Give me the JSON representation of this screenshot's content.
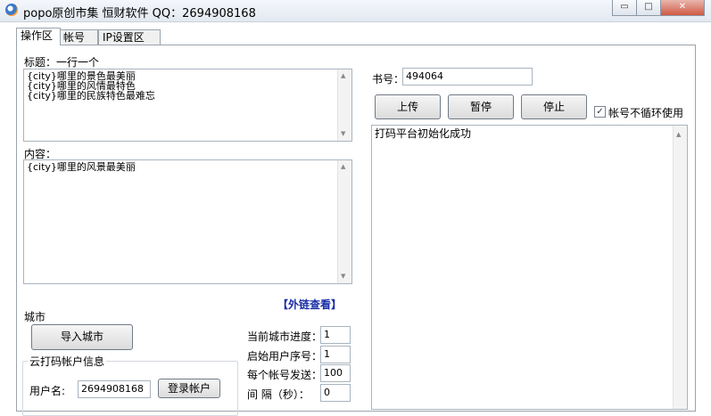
{
  "window": {
    "title": "popo原创市集  恒财软件 QQ：2694908168",
    "minimize_glyph": "▭",
    "restore_glyph": "□",
    "close_glyph": "✕"
  },
  "tabs": [
    {
      "label": "操作区",
      "active": true
    },
    {
      "label": "帐号",
      "active": false
    },
    {
      "label": "IP设置区",
      "active": false
    }
  ],
  "left": {
    "title_label": "标题：一行一个",
    "title_lines": [
      "{city}哪里的景色最美丽",
      "{city}哪里的风情最特色",
      "{city}哪里的民族特色最难忘"
    ],
    "content_label": "内容：",
    "content_lines": [
      "{city}哪里的风景最美丽"
    ],
    "external_link": "【外链查看】",
    "city_label": "城市",
    "import_city_button": "导入城市",
    "cloud_group_title": "云打码帐户信息",
    "username_label": "用户名:",
    "username_value": "2694908168",
    "login_button": "登录帐户",
    "progress_label": "当前城市进度：",
    "progress_value": "1",
    "start_index_label": "启始用户序号：",
    "start_index_value": "1",
    "per_account_label": "每个帐号发送：",
    "per_account_value": "100",
    "interval_label": "间  隔（秒）：",
    "interval_value": "0"
  },
  "right": {
    "book_label": "书号：",
    "book_value": "494064",
    "upload_button": "上传",
    "pause_button": "暂停",
    "stop_button": "停止",
    "no_cycle_checkbox_label": "帐号不循环使用",
    "no_cycle_checked": true,
    "log_lines": [
      "打码平台初始化成功"
    ]
  },
  "colors": {
    "link": "#1a2fa6",
    "title_bar": "#e3e9f1"
  }
}
